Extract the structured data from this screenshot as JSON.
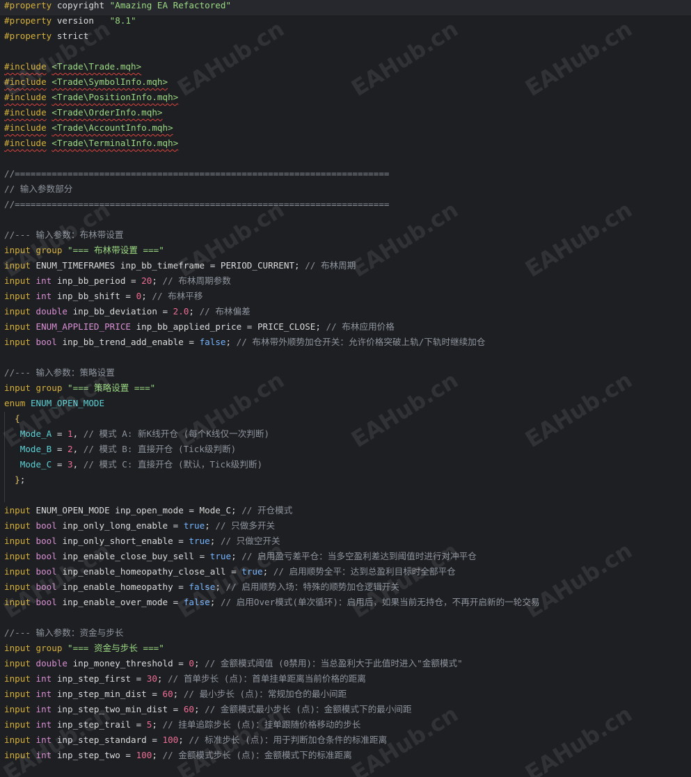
{
  "code_lines": [
    {
      "hl": true,
      "tokens": [
        {
          "t": "#property",
          "c": "kw"
        },
        {
          "t": " copyright "
        },
        {
          "t": "\"Amazing EA Refactored\"",
          "c": "str"
        }
      ]
    },
    {
      "tokens": [
        {
          "t": "#property",
          "c": "kw"
        },
        {
          "t": " version   "
        },
        {
          "t": "\"8.1\"",
          "c": "str"
        }
      ]
    },
    {
      "tokens": [
        {
          "t": "#property",
          "c": "kw"
        },
        {
          "t": " strict"
        }
      ]
    },
    {
      "tokens": []
    },
    {
      "tokens": [
        {
          "t": "#include",
          "c": "kw sq"
        },
        {
          "t": " "
        },
        {
          "t": "<Trade\\Trade.mqh>",
          "c": "str sq"
        }
      ]
    },
    {
      "tokens": [
        {
          "t": "#include",
          "c": "kw sq"
        },
        {
          "t": " "
        },
        {
          "t": "<Trade\\SymbolInfo.mqh>",
          "c": "str sq"
        }
      ]
    },
    {
      "tokens": [
        {
          "t": "#include",
          "c": "kw sq"
        },
        {
          "t": " "
        },
        {
          "t": "<Trade\\PositionInfo.mqh>",
          "c": "str sq"
        }
      ]
    },
    {
      "tokens": [
        {
          "t": "#include",
          "c": "kw sq"
        },
        {
          "t": " "
        },
        {
          "t": "<Trade\\OrderInfo.mqh>",
          "c": "str sq"
        }
      ]
    },
    {
      "tokens": [
        {
          "t": "#include",
          "c": "kw sq"
        },
        {
          "t": " "
        },
        {
          "t": "<Trade\\AccountInfo.mqh>",
          "c": "str sq"
        }
      ]
    },
    {
      "tokens": [
        {
          "t": "#include",
          "c": "kw sq"
        },
        {
          "t": " "
        },
        {
          "t": "<Trade\\TerminalInfo.mqh>",
          "c": "str sq"
        }
      ]
    },
    {
      "tokens": []
    },
    {
      "tokens": [
        {
          "t": "//=======================================================================",
          "c": "cmt"
        }
      ]
    },
    {
      "tokens": [
        {
          "t": "// 输入参数部分",
          "c": "cmt"
        }
      ]
    },
    {
      "tokens": [
        {
          "t": "//=======================================================================",
          "c": "cmt"
        }
      ]
    },
    {
      "tokens": []
    },
    {
      "tokens": [
        {
          "t": "//--- 输入参数：布林带设置",
          "c": "cmt"
        }
      ]
    },
    {
      "tokens": [
        {
          "t": "input",
          "c": "kw"
        },
        {
          "t": " "
        },
        {
          "t": "group",
          "c": "kw"
        },
        {
          "t": " "
        },
        {
          "t": "\"=== 布林带设置 ===\"",
          "c": "str"
        }
      ]
    },
    {
      "tokens": [
        {
          "t": "input",
          "c": "kw"
        },
        {
          "t": " ENUM_TIMEFRAMES inp_bb_timeframe = PERIOD_CURRENT; "
        },
        {
          "t": "// 布林周期",
          "c": "cmt"
        }
      ]
    },
    {
      "tokens": [
        {
          "t": "input",
          "c": "kw"
        },
        {
          "t": " "
        },
        {
          "t": "int",
          "c": "typ"
        },
        {
          "t": " inp_bb_period = "
        },
        {
          "t": "20",
          "c": "num"
        },
        {
          "t": "; "
        },
        {
          "t": "// 布林周期参数",
          "c": "cmt"
        }
      ]
    },
    {
      "tokens": [
        {
          "t": "input",
          "c": "kw"
        },
        {
          "t": " "
        },
        {
          "t": "int",
          "c": "typ"
        },
        {
          "t": " inp_bb_shift = "
        },
        {
          "t": "0",
          "c": "num"
        },
        {
          "t": "; "
        },
        {
          "t": "// 布林平移",
          "c": "cmt"
        }
      ]
    },
    {
      "tokens": [
        {
          "t": "input",
          "c": "kw"
        },
        {
          "t": " "
        },
        {
          "t": "double",
          "c": "typ"
        },
        {
          "t": " inp_bb_deviation = "
        },
        {
          "t": "2.0",
          "c": "num"
        },
        {
          "t": "; "
        },
        {
          "t": "// 布林偏差",
          "c": "cmt"
        }
      ]
    },
    {
      "tokens": [
        {
          "t": "input",
          "c": "kw"
        },
        {
          "t": " "
        },
        {
          "t": "ENUM_APPLIED_PRICE",
          "c": "typ"
        },
        {
          "t": " inp_bb_applied_price = PRICE_CLOSE; "
        },
        {
          "t": "// 布林应用价格",
          "c": "cmt"
        }
      ]
    },
    {
      "tokens": [
        {
          "t": "input",
          "c": "kw"
        },
        {
          "t": " "
        },
        {
          "t": "bool",
          "c": "typ"
        },
        {
          "t": " inp_bb_trend_add_enable = "
        },
        {
          "t": "false",
          "c": "bool"
        },
        {
          "t": "; "
        },
        {
          "t": "// 布林带外顺势加仓开关：允许价格突破上轨/下轨时继续加仓",
          "c": "cmt"
        }
      ]
    },
    {
      "tokens": []
    },
    {
      "tokens": [
        {
          "t": "//--- 输入参数：策略设置",
          "c": "cmt"
        }
      ]
    },
    {
      "tokens": [
        {
          "t": "input",
          "c": "kw"
        },
        {
          "t": " "
        },
        {
          "t": "group",
          "c": "kw"
        },
        {
          "t": " "
        },
        {
          "t": "\"=== 策略设置 ===\"",
          "c": "str"
        }
      ]
    },
    {
      "tokens": [
        {
          "t": "enum",
          "c": "kw"
        },
        {
          "t": " "
        },
        {
          "t": "ENUM_OPEN_MODE",
          "c": "enm"
        }
      ]
    },
    {
      "tokens": [
        {
          "t": "  "
        },
        {
          "t": "{",
          "c": "br"
        }
      ]
    },
    {
      "tokens": [
        {
          "t": "   "
        },
        {
          "t": "Mode_A",
          "c": "enm"
        },
        {
          "t": " = "
        },
        {
          "t": "1",
          "c": "num"
        },
        {
          "t": ", "
        },
        {
          "t": "// 模式 A: 新K线开仓 (每个K线仅一次判断)",
          "c": "cmt"
        }
      ]
    },
    {
      "tokens": [
        {
          "t": "   "
        },
        {
          "t": "Mode_B",
          "c": "enm"
        },
        {
          "t": " = "
        },
        {
          "t": "2",
          "c": "num"
        },
        {
          "t": ", "
        },
        {
          "t": "// 模式 B: 直接开仓 (Tick级判断)",
          "c": "cmt"
        }
      ]
    },
    {
      "tokens": [
        {
          "t": "   "
        },
        {
          "t": "Mode_C",
          "c": "enm"
        },
        {
          "t": " = "
        },
        {
          "t": "3",
          "c": "num"
        },
        {
          "t": ", "
        },
        {
          "t": "// 模式 C: 直接开仓 (默认，Tick级判断)",
          "c": "cmt"
        }
      ]
    },
    {
      "tokens": [
        {
          "t": "  "
        },
        {
          "t": "}",
          "c": "br"
        },
        {
          "t": ";"
        }
      ]
    },
    {
      "tokens": []
    },
    {
      "tokens": [
        {
          "t": "input",
          "c": "kw"
        },
        {
          "t": " ENUM_OPEN_MODE inp_open_mode = Mode_C; "
        },
        {
          "t": "// 开仓模式",
          "c": "cmt"
        }
      ]
    },
    {
      "tokens": [
        {
          "t": "input",
          "c": "kw"
        },
        {
          "t": " "
        },
        {
          "t": "bool",
          "c": "typ"
        },
        {
          "t": " inp_only_long_enable = "
        },
        {
          "t": "true",
          "c": "bool"
        },
        {
          "t": "; "
        },
        {
          "t": "// 只做多开关",
          "c": "cmt"
        }
      ]
    },
    {
      "tokens": [
        {
          "t": "input",
          "c": "kw"
        },
        {
          "t": " "
        },
        {
          "t": "bool",
          "c": "typ"
        },
        {
          "t": " inp_only_short_enable = "
        },
        {
          "t": "true",
          "c": "bool"
        },
        {
          "t": "; "
        },
        {
          "t": "// 只做空开关",
          "c": "cmt"
        }
      ]
    },
    {
      "tokens": [
        {
          "t": "input",
          "c": "kw"
        },
        {
          "t": " "
        },
        {
          "t": "bool",
          "c": "typ"
        },
        {
          "t": " inp_enable_close_buy_sell = "
        },
        {
          "t": "true",
          "c": "bool"
        },
        {
          "t": "; "
        },
        {
          "t": "// 启用盈亏差平仓：当多空盈利差达到阈值时进行对冲平仓",
          "c": "cmt"
        }
      ]
    },
    {
      "tokens": [
        {
          "t": "input",
          "c": "kw"
        },
        {
          "t": " "
        },
        {
          "t": "bool",
          "c": "typ"
        },
        {
          "t": " inp_enable_homeopathy_close_all = "
        },
        {
          "t": "true",
          "c": "bool"
        },
        {
          "t": "; "
        },
        {
          "t": "// 启用顺势全平：达到总盈利目标时全部平仓",
          "c": "cmt"
        }
      ]
    },
    {
      "tokens": [
        {
          "t": "input",
          "c": "kw"
        },
        {
          "t": " "
        },
        {
          "t": "bool",
          "c": "typ"
        },
        {
          "t": " inp_enable_homeopathy = "
        },
        {
          "t": "false",
          "c": "bool"
        },
        {
          "t": "; "
        },
        {
          "t": "// 启用顺势入场：特殊的顺势加仓逻辑开关",
          "c": "cmt"
        }
      ]
    },
    {
      "tokens": [
        {
          "t": "input",
          "c": "kw"
        },
        {
          "t": " "
        },
        {
          "t": "bool",
          "c": "typ"
        },
        {
          "t": " inp_enable_over_mode = "
        },
        {
          "t": "false",
          "c": "bool"
        },
        {
          "t": "; "
        },
        {
          "t": "// 启用Over模式(单次循环)：启用后，如果当前无持仓，不再开启新的一轮交易",
          "c": "cmt"
        }
      ]
    },
    {
      "tokens": []
    },
    {
      "tokens": [
        {
          "t": "//--- 输入参数：资金与步长",
          "c": "cmt"
        }
      ]
    },
    {
      "tokens": [
        {
          "t": "input",
          "c": "kw"
        },
        {
          "t": " "
        },
        {
          "t": "group",
          "c": "kw"
        },
        {
          "t": " "
        },
        {
          "t": "\"=== 资金与步长 ===\"",
          "c": "str"
        }
      ]
    },
    {
      "tokens": [
        {
          "t": "input",
          "c": "kw"
        },
        {
          "t": " "
        },
        {
          "t": "double",
          "c": "typ"
        },
        {
          "t": " inp_money_threshold = "
        },
        {
          "t": "0",
          "c": "num"
        },
        {
          "t": "; "
        },
        {
          "t": "// 金额模式阈值 (0禁用)：当总盈利大于此值时进入\"金额模式\"",
          "c": "cmt"
        }
      ]
    },
    {
      "tokens": [
        {
          "t": "input",
          "c": "kw"
        },
        {
          "t": " "
        },
        {
          "t": "int",
          "c": "typ"
        },
        {
          "t": " inp_step_first = "
        },
        {
          "t": "30",
          "c": "num"
        },
        {
          "t": "; "
        },
        {
          "t": "// 首单步长 (点)：首单挂单距离当前价格的距离",
          "c": "cmt"
        }
      ]
    },
    {
      "tokens": [
        {
          "t": "input",
          "c": "kw"
        },
        {
          "t": " "
        },
        {
          "t": "int",
          "c": "typ"
        },
        {
          "t": " inp_step_min_dist = "
        },
        {
          "t": "60",
          "c": "num"
        },
        {
          "t": "; "
        },
        {
          "t": "// 最小步长 (点)：常规加仓的最小间距",
          "c": "cmt"
        }
      ]
    },
    {
      "tokens": [
        {
          "t": "input",
          "c": "kw"
        },
        {
          "t": " "
        },
        {
          "t": "int",
          "c": "typ"
        },
        {
          "t": " inp_step_two_min_dist = "
        },
        {
          "t": "60",
          "c": "num"
        },
        {
          "t": "; "
        },
        {
          "t": "// 金额模式最小步长 (点)：金额模式下的最小间距",
          "c": "cmt"
        }
      ]
    },
    {
      "tokens": [
        {
          "t": "input",
          "c": "kw"
        },
        {
          "t": " "
        },
        {
          "t": "int",
          "c": "typ"
        },
        {
          "t": " inp_step_trail = "
        },
        {
          "t": "5",
          "c": "num"
        },
        {
          "t": "; "
        },
        {
          "t": "// 挂单追踪步长 (点)：挂单跟随价格移动的步长",
          "c": "cmt"
        }
      ]
    },
    {
      "tokens": [
        {
          "t": "input",
          "c": "kw"
        },
        {
          "t": " "
        },
        {
          "t": "int",
          "c": "typ"
        },
        {
          "t": " inp_step_standard = "
        },
        {
          "t": "100",
          "c": "num"
        },
        {
          "t": "; "
        },
        {
          "t": "// 标准步长 (点)：用于判断加仓条件的标准距离",
          "c": "cmt"
        }
      ]
    },
    {
      "tokens": [
        {
          "t": "input",
          "c": "kw"
        },
        {
          "t": " "
        },
        {
          "t": "int",
          "c": "typ"
        },
        {
          "t": " inp_step_two = "
        },
        {
          "t": "100",
          "c": "num"
        },
        {
          "t": "; "
        },
        {
          "t": "// 金额模式步长 (点)：金额模式下的标准距离",
          "c": "cmt"
        }
      ]
    }
  ],
  "watermark": {
    "text": "EAHub.cn"
  }
}
